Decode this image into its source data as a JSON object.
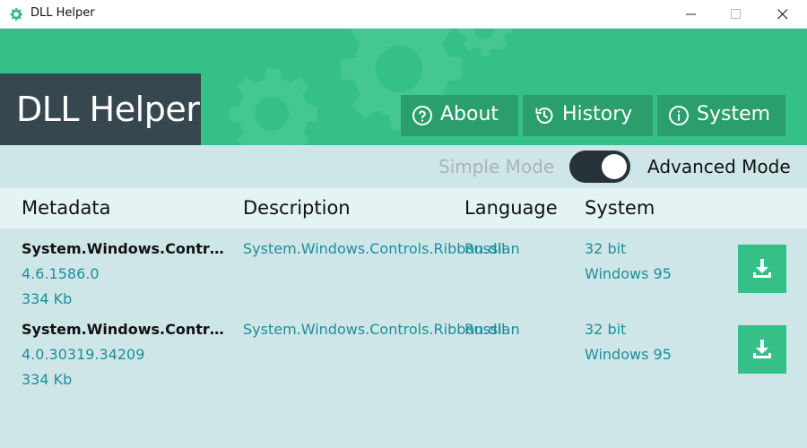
{
  "window": {
    "title": "DLL Helper"
  },
  "header": {
    "brand": "DLL Helper",
    "nav": [
      {
        "label": "About",
        "icon": "question-circle-icon"
      },
      {
        "label": "History",
        "icon": "history-icon"
      },
      {
        "label": "System",
        "icon": "info-circle-icon"
      }
    ]
  },
  "mode": {
    "simple_label": "Simple Mode",
    "advanced_label": "Advanced Mode",
    "advanced_enabled": true
  },
  "table": {
    "columns": [
      "Metadata",
      "Description",
      "Language",
      "System"
    ],
    "rows": [
      {
        "name": "System.Windows.Controls...",
        "version": "4.6.1586.0",
        "size": "334 Kb",
        "description": "System.Windows.Controls.Ribbon.dll",
        "language": "Russian",
        "bits": "32 bit",
        "os": "Windows 95",
        "action_icon": "download-icon"
      },
      {
        "name": "System.Windows.Controls...",
        "version": "4.0.30319.34209",
        "size": "334 Kb",
        "description": "System.Windows.Controls.Ribbon.dll",
        "language": "Russian",
        "bits": "32 bit",
        "os": "Windows 95",
        "action_icon": "download-icon"
      }
    ]
  },
  "colors": {
    "accent_green": "#35c088",
    "nav_green": "#2a9e6d",
    "brand_dark": "#37474f",
    "link_teal": "#1a8f9a",
    "background": "#cfe6e8"
  }
}
